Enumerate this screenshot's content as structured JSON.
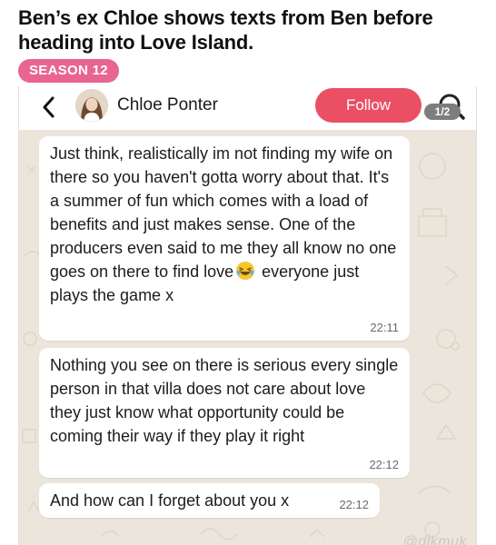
{
  "headline": "Ben’s ex Chloe shows texts from Ben before heading into Love Island.",
  "badge": "SEASON 12",
  "chat": {
    "contact_name": "Chloe Ponter",
    "follow_label": "Follow",
    "image_counter": "1/2",
    "icons": {
      "back": "chevron-left-icon",
      "search": "search-icon",
      "emoji": "laughing-tears-emoji"
    },
    "messages": [
      {
        "text_before": "Just think, realistically im not finding my wife on there so you haven't gotta worry about that. It's a summer of fun which comes with a load of benefits and just makes sense. One of the producers even said to me they all know no one goes on there to find love",
        "text_after": " everyone just plays the game x",
        "time": "22:11"
      },
      {
        "text": "Nothing you see on there is serious every single person in that villa does not care about love they just know what opportunity could be coming their way if they play it right",
        "time": "22:12"
      },
      {
        "text": "And how can I forget about you x",
        "time": "22:12"
      }
    ],
    "watermark": "@dlkmuk"
  },
  "colors": {
    "badge": "#e8658f",
    "follow": "#ea4f64",
    "chat_background": "#ece5dc",
    "bubble": "#ffffff"
  }
}
